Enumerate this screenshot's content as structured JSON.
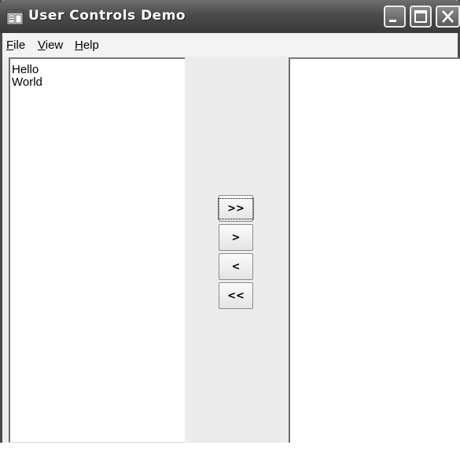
{
  "window": {
    "title": "User Controls Demo"
  },
  "icons": {
    "app": "app-window-icon",
    "minimize": "minimize-icon",
    "maximize": "maximize-icon",
    "close": "close-icon"
  },
  "menu": {
    "items": [
      {
        "accel": "F",
        "rest": "ile"
      },
      {
        "accel": "V",
        "rest": "iew"
      },
      {
        "accel": "H",
        "rest": "elp"
      }
    ]
  },
  "left_list": {
    "items": [
      "Hello",
      "World"
    ]
  },
  "right_list": {
    "items": []
  },
  "move_buttons": {
    "move_all_right": ">>",
    "move_right": ">",
    "move_left": "<",
    "move_all_left": "<<"
  }
}
